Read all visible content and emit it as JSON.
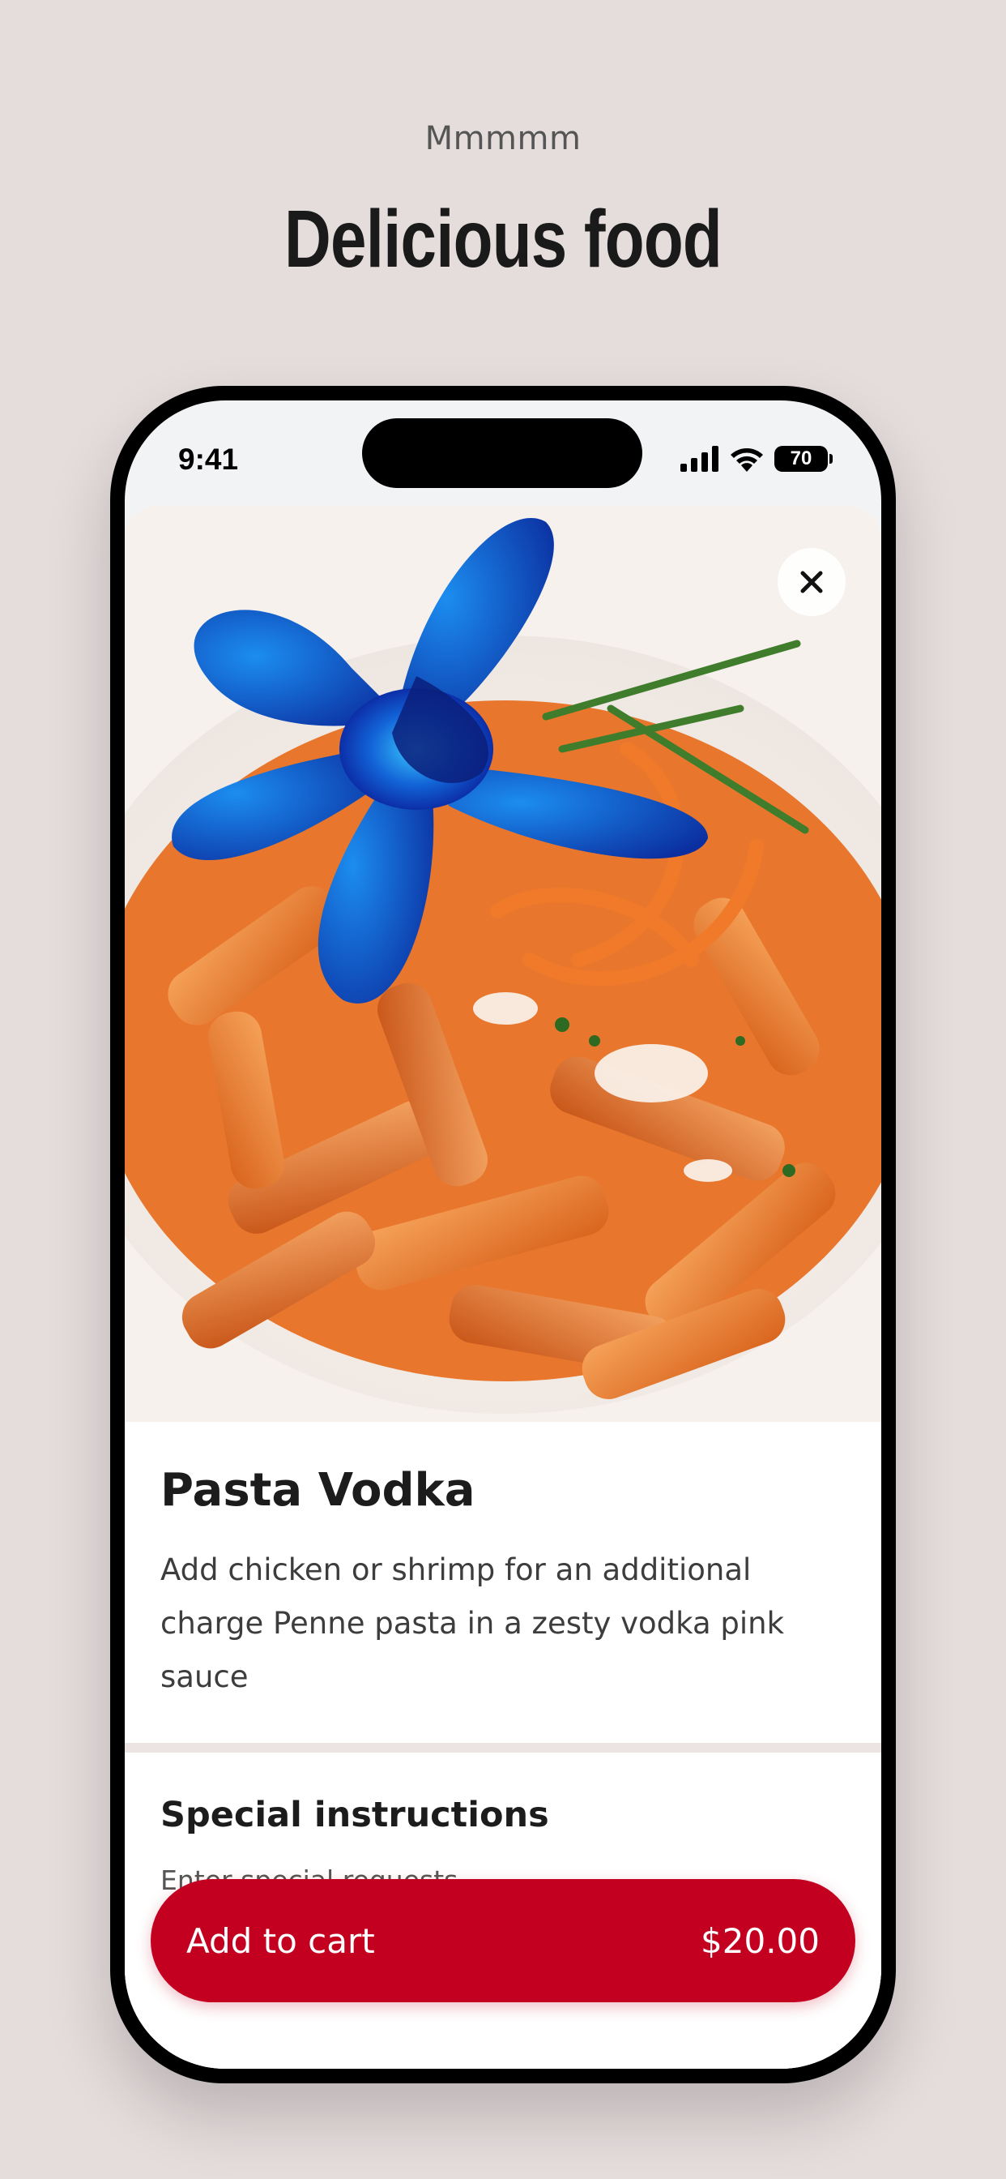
{
  "header": {
    "eyebrow": "Mmmmm",
    "headline": "Delicious food"
  },
  "status_bar": {
    "time": "9:41",
    "battery": "70",
    "icons": [
      "cellular-signal-icon",
      "wifi-icon",
      "battery-icon"
    ]
  },
  "item": {
    "title": "Pasta Vodka",
    "description": "Add chicken or shrimp for an additional charge Penne pasta in a zesty vodka pink sauce",
    "image_alt": "pasta-photo"
  },
  "instructions": {
    "title": "Special instructions",
    "placeholder": "Enter special requests"
  },
  "cart": {
    "label": "Add to cart",
    "price": "$20.00"
  },
  "colors": {
    "background": "#e5dcdc",
    "accent": "#c40020",
    "text_primary": "#1c1c1c"
  }
}
